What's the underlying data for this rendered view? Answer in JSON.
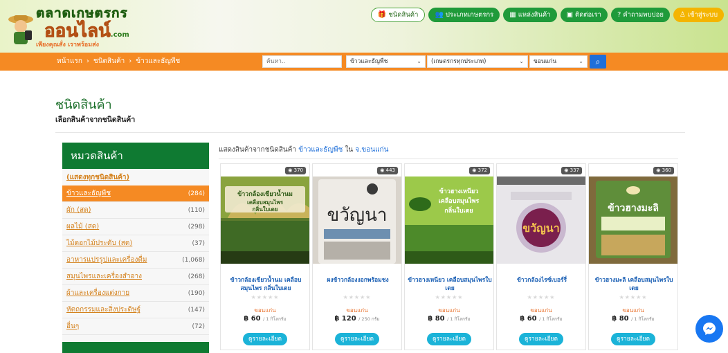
{
  "header": {
    "logo_line1": "ตลาดเกษตรกร",
    "logo_line2": "ออนไลน์",
    "logo_domain": ".com",
    "logo_tagline": "เพียงคุณสั่ง เราพร้อมส่ง",
    "nav": [
      {
        "label": "ชนิดสินค้า",
        "icon": "gift-icon"
      },
      {
        "label": "ประเภทเกษตรกร",
        "icon": "users-icon"
      },
      {
        "label": "แหล่งสินค้า",
        "icon": "map-icon"
      },
      {
        "label": "ติดต่อเรา",
        "icon": "contact-icon"
      },
      {
        "label": "คำถามพบบ่อย",
        "icon": "question-icon"
      },
      {
        "label": "เข้าสู่ระบบ",
        "icon": "user-icon"
      }
    ]
  },
  "breadcrumb": [
    "หน้าแรก",
    "ชนิดสินค้า",
    "ข้าวและธัญพืช"
  ],
  "search": {
    "placeholder": "ค้นหา..",
    "category_value": "ข้าวและธัญพืช",
    "farmer_type_value": "(เกษตรกรทุกประเภท)",
    "province_value": "ขอนแก่น"
  },
  "page": {
    "title": "ชนิดสินค้า",
    "subtitle": "เลือกสินค้าจากชนิดสินค้า"
  },
  "sidebar": {
    "title": "หมวดสินค้า",
    "all_label": "(แสดงทุกชนิดสินค้า)",
    "items": [
      {
        "label": "ข้าวและธัญพืช",
        "count": "(284)",
        "active": true
      },
      {
        "label": "ผัก (สด)",
        "count": "(110)",
        "active": false
      },
      {
        "label": "ผลไม้ (สด)",
        "count": "(298)",
        "active": false
      },
      {
        "label": "ไม้ดอกไม้ประดับ (สด)",
        "count": "(37)",
        "active": false
      },
      {
        "label": "อาหารแปรรูปและเครื่องดื่ม",
        "count": "(1,068)",
        "active": false
      },
      {
        "label": "สมุนไพรและเครื่องสำอาง",
        "count": "(268)",
        "active": false
      },
      {
        "label": "ผ้าและเครื่องแต่งกาย",
        "count": "(190)",
        "active": false
      },
      {
        "label": "หัตถกรรมและสิ่งประดิษฐ์",
        "count": "(147)",
        "active": false
      },
      {
        "label": "อื่นๆ",
        "count": "(72)",
        "active": false
      }
    ]
  },
  "listing": {
    "prefix": "แสดงสินค้าจากชนิดสินค้า",
    "category": "ข้าวและธัญพืช",
    "mid": "ใน",
    "province": "จ.ขอนแก่น"
  },
  "products": [
    {
      "views": "370",
      "name": "ข้าวกล้องเขียวน้ำนม เคลือบสมุนไพร กลิ่นใบเตย",
      "province": "ขอนแก่น",
      "price": "฿ 60",
      "unit": "/ 1 กิโลกรัม",
      "detail_label": "ดูรายละเอียด",
      "img_text": "ข้าวกล้องเขียวน้ำนม เคลือบสมุนไพร กลิ่นใบเตย"
    },
    {
      "views": "443",
      "name": "ผงข้าวกล้องงอกพร้อมชง",
      "province": "ขอนแก่น",
      "price": "฿ 120",
      "unit": "/ 250 กรัม",
      "detail_label": "ดูรายละเอียด",
      "img_text": "ขวัญนา"
    },
    {
      "views": "372",
      "name": "ข้าวฮางเหนียว เคลือบสมุนไพรใบเตย",
      "province": "ขอนแก่น",
      "price": "฿ 80",
      "unit": "/ 1 กิโลกรัม",
      "detail_label": "ดูรายละเอียด",
      "img_text": "ข้าวฮางเหนียว เคลือบสมุนไพร กลิ่นใบเตย"
    },
    {
      "views": "337",
      "name": "ข้าวกล้องไรซ์เบอร์รี่",
      "province": "ขอนแก่น",
      "price": "฿ 60",
      "unit": "/ 1 กิโลกรัม",
      "detail_label": "ดูรายละเอียด",
      "img_text": "ขวัญนา"
    },
    {
      "views": "360",
      "name": "ข้าวฮางมะลิ เคลือบสมุนไพรใบเตย",
      "province": "ขอนแก่น",
      "price": "฿ 80",
      "unit": "/ 1 กิโลกรัม",
      "detail_label": "ดูรายละเอียด",
      "img_text": "ข้าวฮางมะลิ"
    }
  ],
  "colors": {
    "brand_green": "#0f7a32",
    "brand_orange": "#f58a23",
    "link_blue": "#1a5fb4",
    "button_cyan": "#1bb3d8"
  }
}
